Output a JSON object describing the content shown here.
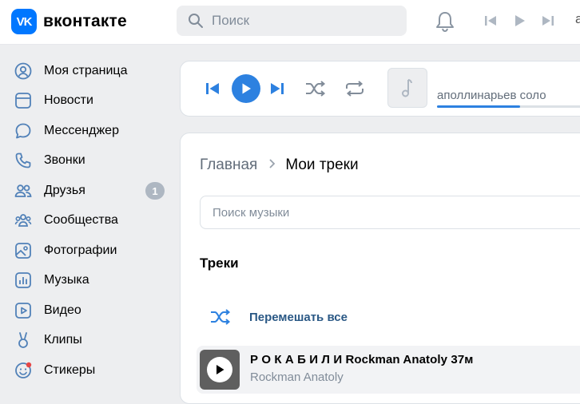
{
  "header": {
    "logo_text": "вконтакте",
    "logo_badge": "VK",
    "search_placeholder": "Поиск",
    "truncated_text": "a"
  },
  "sidebar": {
    "items": [
      {
        "label": "Моя страница",
        "icon": "user-circle-icon"
      },
      {
        "label": "Новости",
        "icon": "news-icon"
      },
      {
        "label": "Мессенджер",
        "icon": "message-icon"
      },
      {
        "label": "Звонки",
        "icon": "phone-icon"
      },
      {
        "label": "Друзья",
        "icon": "friends-icon",
        "badge": "1"
      },
      {
        "label": "Сообщества",
        "icon": "communities-icon"
      },
      {
        "label": "Фотографии",
        "icon": "photo-icon"
      },
      {
        "label": "Музыка",
        "icon": "music-icon"
      },
      {
        "label": "Видео",
        "icon": "video-icon"
      },
      {
        "label": "Клипы",
        "icon": "clips-icon"
      },
      {
        "label": "Стикеры",
        "icon": "stickers-icon"
      }
    ]
  },
  "player": {
    "track_name": "аполлинарьев соло",
    "progress": 0.52
  },
  "main": {
    "breadcrumb_home": "Главная",
    "breadcrumb_current": "Мои треки",
    "search_placeholder": "Поиск музыки",
    "section_title": "Треки",
    "shuffle_label": "Перемешать все",
    "tracks": [
      {
        "title": "Р О К А Б И Л И Rockman Anatoly 37м",
        "artist": "Rockman Anatoly"
      }
    ]
  },
  "colors": {
    "accent": "#2d81e0",
    "brand": "#0077ff",
    "link": "#2a5885",
    "muted": "#818c99",
    "icon": "#5181b8"
  }
}
